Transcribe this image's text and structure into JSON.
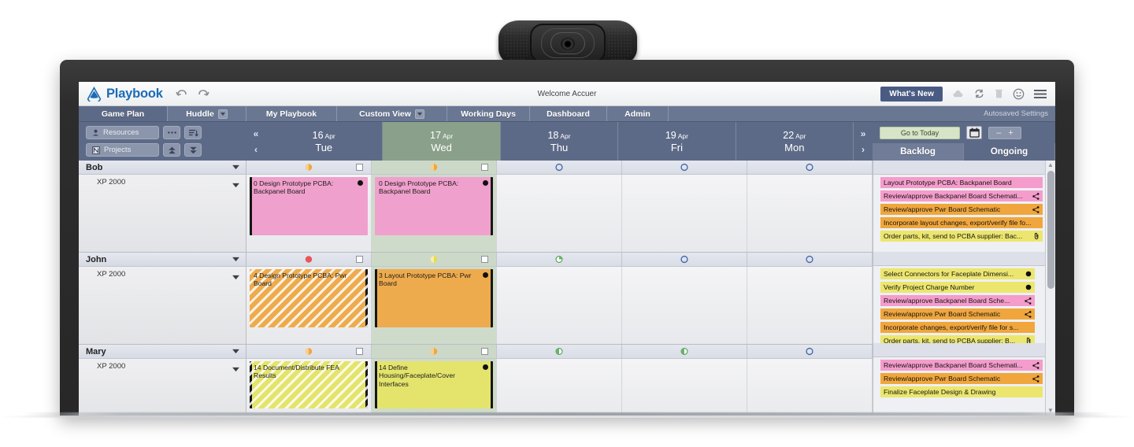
{
  "app": {
    "brand": "Playbook",
    "welcome": "Welcome Accuer",
    "whats_new": "What's New",
    "autosaved": "Autosaved Settings",
    "accent_blue": "#1b6cb5",
    "chrome_blue": "#5d6a87",
    "today_green": "#8aa08a"
  },
  "title_icons": [
    {
      "name": "undo-icon",
      "glyph": "undo"
    },
    {
      "name": "redo-icon",
      "glyph": "redo"
    },
    {
      "name": "cloud-icon",
      "glyph": "cloud"
    },
    {
      "name": "sync-icon",
      "glyph": "sync"
    },
    {
      "name": "trash-icon",
      "glyph": "trash"
    },
    {
      "name": "smiley-icon",
      "glyph": "smiley"
    },
    {
      "name": "hamburger-menu-icon",
      "glyph": "menu"
    }
  ],
  "tabs": [
    {
      "label": "Game Plan",
      "active": true,
      "caret": false
    },
    {
      "label": "Huddle",
      "active": false,
      "caret": true
    },
    {
      "label": "My Playbook",
      "active": false,
      "caret": false
    },
    {
      "label": "Custom View",
      "active": false,
      "caret": true
    },
    {
      "label": "Working Days",
      "active": false,
      "caret": false
    },
    {
      "label": "Dashboard",
      "active": false,
      "caret": false
    },
    {
      "label": "Admin",
      "active": false,
      "caret": false
    }
  ],
  "toolbar": {
    "resources_label": "Resources",
    "projects_label": "Projects",
    "more_label": "•••",
    "go_to_today": "Go to Today",
    "zoom_minus": "–",
    "zoom_plus": "+",
    "backlog_tab": "Backlog",
    "ongoing_tab": "Ongoing"
  },
  "date_nav": {
    "prev_double": "«",
    "prev_single": "‹",
    "next_double": "»",
    "next_single": "›"
  },
  "days": [
    {
      "date": "16",
      "month": "Apr",
      "name": "Tue",
      "today": false
    },
    {
      "date": "17",
      "month": "Apr",
      "name": "Wed",
      "today": true
    },
    {
      "date": "18",
      "month": "Apr",
      "name": "Thu",
      "today": false
    },
    {
      "date": "19",
      "month": "Apr",
      "name": "Fri",
      "today": false
    },
    {
      "date": "22",
      "month": "Apr",
      "name": "Mon",
      "today": false
    }
  ],
  "people": [
    {
      "name": "Bob",
      "project": "XP 2000",
      "status_icons": [
        "load-orange-full",
        "load-orange-full",
        "circle-empty-blue",
        "circle-empty-blue",
        "circle-empty-blue"
      ],
      "cards": [
        {
          "day": 0,
          "text": "0 Design Prototype PCBA: Backpanel Board",
          "color": "#f0a0cc",
          "hatched": false,
          "dot": true,
          "edge": "left"
        },
        {
          "day": 1,
          "text": "0 Design Prototype PCBA: Backpanel Board",
          "color": "#f0a0cc",
          "hatched": false,
          "dot": true,
          "edge": "right"
        }
      ],
      "backlog": [
        {
          "text": "Layout Prototype PCBA: Backpanel Board",
          "color": "#f49ccb",
          "icon": ""
        },
        {
          "text": "Review/approve Backpanel Board Schemati...",
          "color": "#f49ccb",
          "icon": "share"
        },
        {
          "text": "Review/approve Pwr Board Schematic",
          "color": "#f0a63c",
          "icon": "share"
        },
        {
          "text": "Incorporate layout changes, export/verify file fo...",
          "color": "#f0a63c",
          "icon": ""
        },
        {
          "text": "Order parts, kit, send to PCBA supplier: Bac...",
          "color": "#ece66e",
          "icon": "clip"
        }
      ],
      "scrollbar": false
    },
    {
      "name": "John",
      "project": "XP 2000",
      "status_icons": [
        "circle-full-red",
        "load-yellow-half",
        "pie-green-quarter",
        "circle-empty-blue",
        "circle-empty-blue"
      ],
      "cards": [
        {
          "day": 0,
          "text": "4 Design Prototype PCBA: Pwr Board",
          "color": "#eeab4d",
          "hatched": true,
          "dot": false,
          "edge": "right"
        },
        {
          "day": 1,
          "text": "3 Layout Prototype PCBA: Pwr Board",
          "color": "#eeab4d",
          "hatched": false,
          "dot": true,
          "edge": "both"
        }
      ],
      "backlog": [
        {
          "text": "Select Connectors for Faceplate Dimensi...",
          "color": "#ece66e",
          "icon": "dot"
        },
        {
          "text": "Verify Project Charge Number",
          "color": "#ece66e",
          "icon": "dot"
        },
        {
          "text": "Review/approve Backpanel Board Sche...",
          "color": "#f49ccb",
          "icon": "share"
        },
        {
          "text": "Review/approve Pwr Board Schematic",
          "color": "#f0a63c",
          "icon": "share"
        },
        {
          "text": "Incorporate changes, export/verify file for s...",
          "color": "#f0a63c",
          "icon": ""
        },
        {
          "text": "Order parts, kit, send to PCBA supplier: B...",
          "color": "#ece66e",
          "icon": "clip"
        }
      ],
      "scrollbar": true
    },
    {
      "name": "Mary",
      "project": "XP 2000",
      "status_icons": [
        "load-orange-full",
        "load-orange-full",
        "circle-half-green",
        "circle-half-green",
        "circle-empty-blue"
      ],
      "cards": [
        {
          "day": 0,
          "text": "14 Document/Distribute FEA Results",
          "color": "#e4e46c",
          "hatched": true,
          "dot": false,
          "edge": "both"
        },
        {
          "day": 1,
          "text": "14 Define Housing/Faceplate/Cover Interfaces",
          "color": "#e4e46c",
          "hatched": false,
          "dot": true,
          "edge": "both"
        }
      ],
      "backlog": [
        {
          "text": "Review/approve Backpanel Board Schemati...",
          "color": "#f49ccb",
          "icon": "share"
        },
        {
          "text": "Review/approve Pwr Board Schematic",
          "color": "#f0a63c",
          "icon": "share"
        },
        {
          "text": "Finalize Faceplate Design & Drawing",
          "color": "#ece66e",
          "icon": ""
        }
      ],
      "scrollbar": false
    }
  ]
}
